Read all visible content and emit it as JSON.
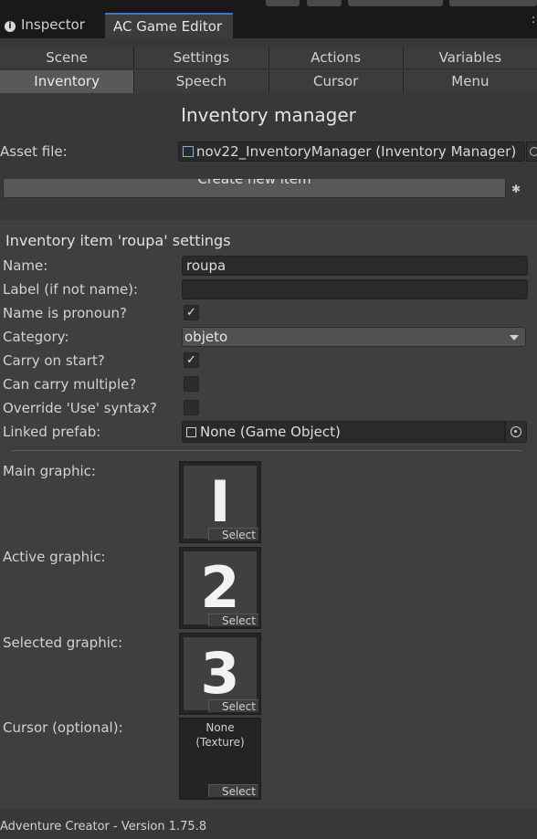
{
  "window_tabs": {
    "inspector": "Inspector",
    "editor": "AC Game Editor"
  },
  "categories_row1": [
    "Scene",
    "Settings",
    "Actions",
    "Variables"
  ],
  "categories_row2": [
    "Inventory",
    "Speech",
    "Cursor",
    "Menu"
  ],
  "active_category": "Inventory",
  "title": "Inventory manager",
  "asset": {
    "label": "Asset file:",
    "value": "nov22_InventoryManager (Inventory Manager)"
  },
  "create_button": "Create new item",
  "item": {
    "heading": "Inventory item 'roupa' settings",
    "name": {
      "label": "Name:",
      "value": "roupa"
    },
    "alt_label": {
      "label": "Label (if not name):",
      "value": ""
    },
    "pronoun": {
      "label": "Name is pronoun?",
      "checked": true
    },
    "category": {
      "label": "Category:",
      "value": "objeto"
    },
    "carry_on_start": {
      "label": "Carry on start?",
      "checked": true
    },
    "carry_multiple": {
      "label": "Can carry multiple?",
      "checked": false
    },
    "override_use": {
      "label": "Override 'Use' syntax?",
      "checked": false
    },
    "linked_prefab": {
      "label": "Linked prefab:",
      "value": "None (Game Object)"
    },
    "graphics": [
      {
        "label": "Main graphic:",
        "glyph": "I",
        "button": "Select"
      },
      {
        "label": "Active graphic:",
        "glyph": "2",
        "button": "Select"
      },
      {
        "label": "Selected graphic:",
        "glyph": "3",
        "button": "Select"
      },
      {
        "label": "Cursor (optional):",
        "none_text": "None (Texture)",
        "button": "Select"
      }
    ]
  },
  "footer": "Adventure Creator - Version 1.75.8",
  "colors": {
    "background": "#383838",
    "tab_accent": "#3a79bb",
    "active_cell": "#595959",
    "field": "#2a2a2a"
  }
}
